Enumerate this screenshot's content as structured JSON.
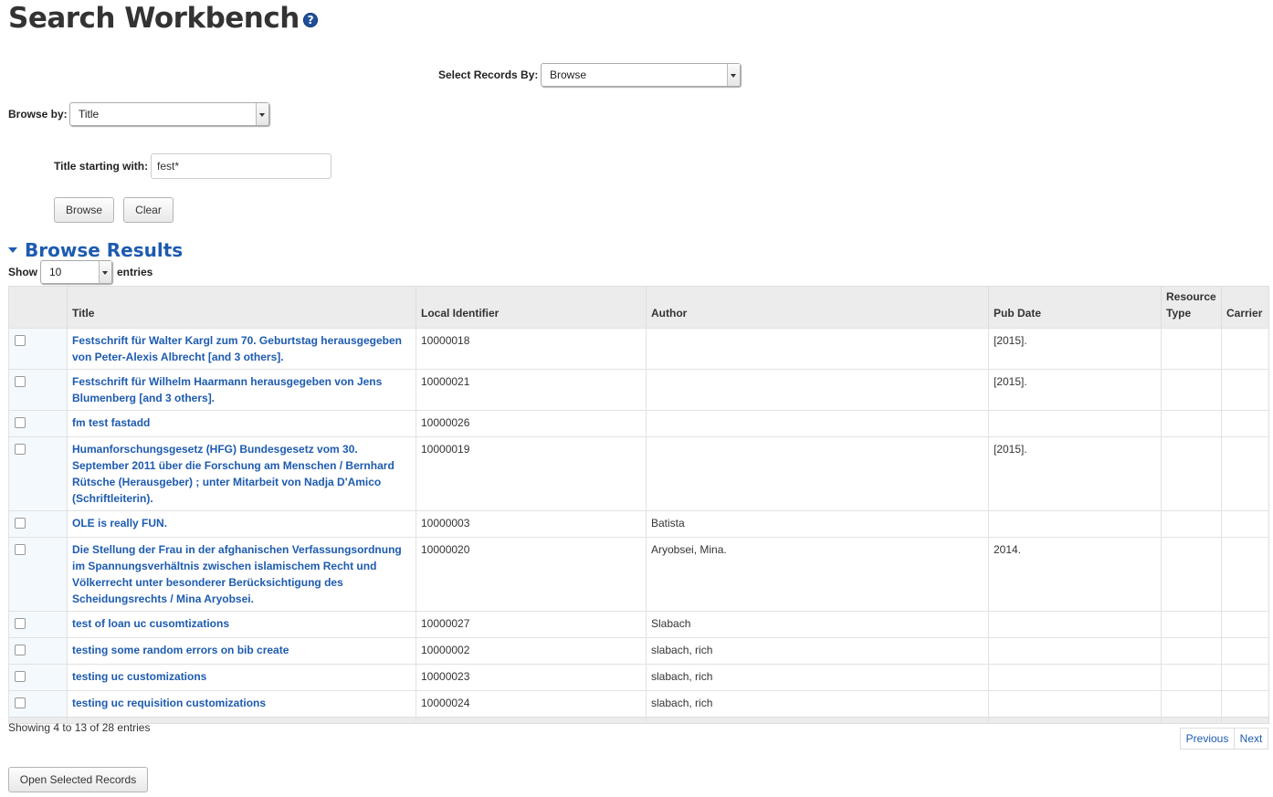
{
  "header": {
    "title": "Search Workbench",
    "help_glyph": "?"
  },
  "select_records": {
    "label": "Select Records By:",
    "value": "Browse"
  },
  "browse_by": {
    "label": "Browse by:",
    "value": "Title"
  },
  "title_search": {
    "label": "Title starting with:",
    "value": "fest*"
  },
  "buttons": {
    "browse": "Browse",
    "clear": "Clear",
    "open_selected": "Open Selected Records"
  },
  "results": {
    "heading": "Browse Results",
    "show_label": "Show",
    "show_value": "10",
    "entries_label": "entries",
    "columns": [
      "Title",
      "Local Identifier",
      "Author",
      "Pub Date",
      "Resource Type",
      "Carrier"
    ],
    "rows": [
      {
        "title": "Festschrift für Walter Kargl zum 70. Geburtstag herausgegeben von Peter-Alexis Albrecht [and 3 others].",
        "id": "10000018",
        "author": "",
        "pub_date": "[2015].",
        "resource_type": "",
        "carrier": ""
      },
      {
        "title": "Festschrift für Wilhelm Haarmann herausgegeben von Jens Blumenberg [and 3 others].",
        "id": "10000021",
        "author": "",
        "pub_date": "[2015].",
        "resource_type": "",
        "carrier": ""
      },
      {
        "title": "fm test fastadd",
        "id": "10000026",
        "author": "",
        "pub_date": "",
        "resource_type": "",
        "carrier": ""
      },
      {
        "title": "Humanforschungsgesetz (HFG) Bundesgesetz vom 30. September 2011 über die Forschung am Menschen / Bernhard Rütsche (Herausgeber) ; unter Mitarbeit von Nadja D'Amico (Schriftleiterin).",
        "id": "10000019",
        "author": "",
        "pub_date": "[2015].",
        "resource_type": "",
        "carrier": ""
      },
      {
        "title": "OLE is really FUN.",
        "id": "10000003",
        "author": "Batista",
        "pub_date": "",
        "resource_type": "",
        "carrier": ""
      },
      {
        "title": "Die Stellung der Frau in der afghanischen Verfassungsordnung im Spannungsverhältnis zwischen islamischem Recht und Völkerrecht unter besonderer Berücksichtigung des Scheidungsrechts / Mina Aryobsei.",
        "id": "10000020",
        "author": "Aryobsei, Mina.",
        "pub_date": "2014.",
        "resource_type": "",
        "carrier": ""
      },
      {
        "title": "test of loan uc cusomtizations",
        "id": "10000027",
        "author": "Slabach",
        "pub_date": "",
        "resource_type": "",
        "carrier": ""
      },
      {
        "title": "testing some random errors on bib create",
        "id": "10000002",
        "author": "slabach, rich",
        "pub_date": "",
        "resource_type": "",
        "carrier": ""
      },
      {
        "title": "testing uc customizations",
        "id": "10000023",
        "author": "slabach, rich",
        "pub_date": "",
        "resource_type": "",
        "carrier": ""
      },
      {
        "title": "testing uc requisition customizations",
        "id": "10000024",
        "author": "slabach, rich",
        "pub_date": "",
        "resource_type": "",
        "carrier": ""
      }
    ],
    "summary": "Showing 4 to 13 of 28 entries",
    "pager": {
      "previous": "Previous",
      "next": "Next"
    }
  },
  "colors": {
    "link": "#1d5bb0",
    "header_bg": "#ececec",
    "help_icon": "#1f4f9a"
  }
}
